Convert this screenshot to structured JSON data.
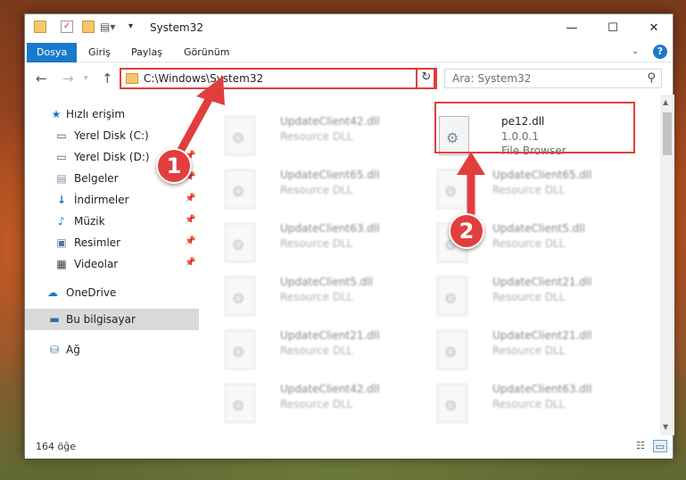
{
  "window": {
    "title": "System32",
    "controls": {
      "minimize": "—",
      "maximize": "☐",
      "close": "✕"
    }
  },
  "ribbon": {
    "tabs": [
      {
        "label": "Dosya",
        "active": true
      },
      {
        "label": "Giriş",
        "active": false
      },
      {
        "label": "Paylaş",
        "active": false
      },
      {
        "label": "Görünüm",
        "active": false
      }
    ],
    "help": "?"
  },
  "navigation": {
    "back": "←",
    "forward": "→",
    "up": "↑",
    "address": "C:\\Windows\\System32",
    "refresh": "↻",
    "search_placeholder": "Ara: System32"
  },
  "sidebar": {
    "items": [
      {
        "label": "Hızlı erişim",
        "icon": "star-icon",
        "pinned": false
      },
      {
        "label": "Yerel Disk (C:)",
        "icon": "drive-icon",
        "pinned": false
      },
      {
        "label": "Yerel Disk (D:)",
        "icon": "drive-icon",
        "pinned": true
      },
      {
        "label": "Belgeler",
        "icon": "documents-icon",
        "pinned": true
      },
      {
        "label": "İndirmeler",
        "icon": "downloads-icon",
        "pinned": true
      },
      {
        "label": "Müzik",
        "icon": "music-icon",
        "pinned": true
      },
      {
        "label": "Resimler",
        "icon": "pictures-icon",
        "pinned": true
      },
      {
        "label": "Videolar",
        "icon": "videos-icon",
        "pinned": true
      },
      {
        "label": "OneDrive",
        "icon": "cloud-icon",
        "pinned": false
      },
      {
        "label": "Bu bilgisayar",
        "icon": "computer-icon",
        "pinned": false,
        "selected": true
      },
      {
        "label": "Ağ",
        "icon": "network-icon",
        "pinned": false
      }
    ]
  },
  "files": {
    "highlighted": {
      "name": "pe12.dll",
      "version": "1.0.0.1",
      "description": "File Browser"
    },
    "left_column": [
      {
        "name": "UpdateClient42.dll",
        "type": "Resource DLL"
      },
      {
        "name": "UpdateClient65.dll",
        "type": "Resource DLL"
      },
      {
        "name": "UpdateClient63.dll",
        "type": "Resource DLL"
      },
      {
        "name": "UpdateClient5.dll",
        "type": "Resource DLL"
      },
      {
        "name": "UpdateClient21.dll",
        "type": "Resource DLL"
      },
      {
        "name": "UpdateClient42.dll",
        "type": "Resource DLL"
      }
    ],
    "right_column": [
      {
        "name": "UpdateClient65.dll",
        "type": "Resource DLL"
      },
      {
        "name": "UpdateClient5.dll",
        "type": "Resource DLL"
      },
      {
        "name": "UpdateClient21.dll",
        "type": "Resource DLL"
      },
      {
        "name": "UpdateClient21.dll",
        "type": "Resource DLL"
      },
      {
        "name": "UpdateClient63.dll",
        "type": "Resource DLL"
      }
    ]
  },
  "status": {
    "item_count": "164 öğe"
  },
  "callouts": [
    "1",
    "2"
  ],
  "colors": {
    "accent": "#1979ca",
    "annotation_red": "#e23e3e"
  }
}
